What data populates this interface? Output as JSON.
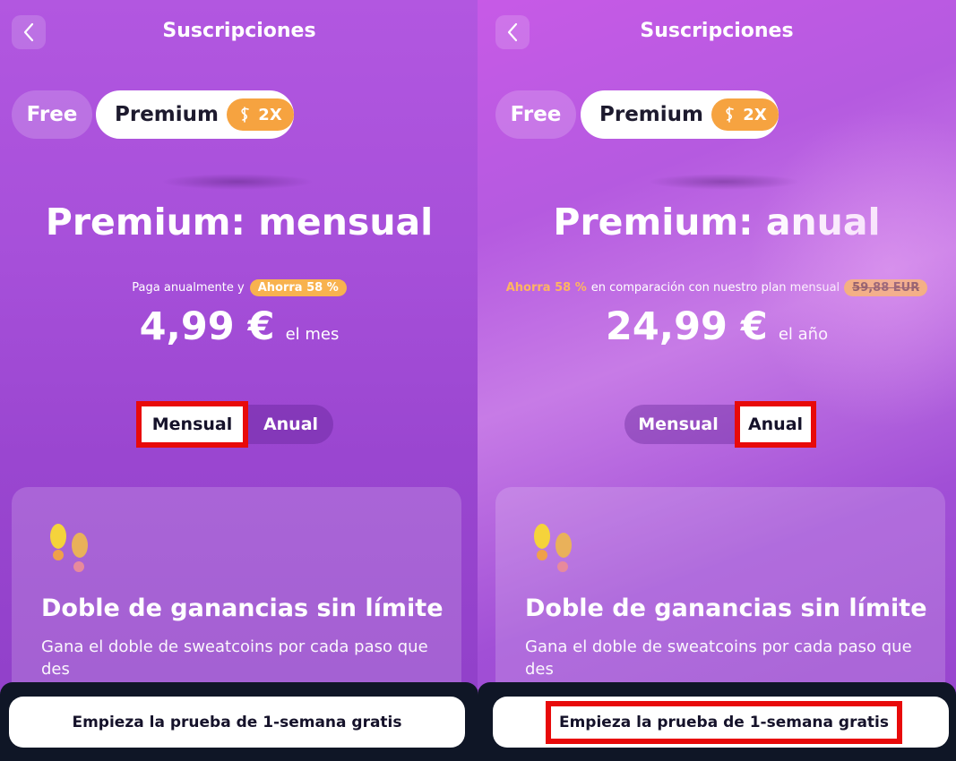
{
  "colors": {
    "accent_orange": "#f6a340",
    "highlight_red": "#e80a0a",
    "purple_bg": "#a64fd9",
    "dark_bar": "#0f1626"
  },
  "left": {
    "header": {
      "back_icon": "chevron-left-icon",
      "title": "Suscripciones"
    },
    "tiers": {
      "free": "Free",
      "premium": "Premium",
      "badge": "2X",
      "badge_icon": "sweatcoin-icon"
    },
    "plan_title": "Premium: mensual",
    "promo": {
      "text": "Paga anualmente y",
      "badge": "Ahorra 58 %"
    },
    "price": {
      "amount": "4,99 €",
      "period": "el mes"
    },
    "toggle": {
      "monthly": "Mensual",
      "annual": "Anual",
      "selected": "Mensual"
    },
    "feature": {
      "icon": "footprints-icon",
      "title": "Doble de ganancias sin límite",
      "description": "Gana el doble de sweatcoins por cada paso que des"
    },
    "cta": "Empieza la prueba de 1-semana gratis"
  },
  "right": {
    "header": {
      "back_icon": "chevron-left-icon",
      "title": "Suscripciones"
    },
    "tiers": {
      "free": "Free",
      "premium": "Premium",
      "badge": "2X",
      "badge_icon": "sweatcoin-icon"
    },
    "plan_title": "Premium: anual",
    "promo": {
      "highlight": "Ahorra 58 %",
      "text": "en comparación con nuestro plan mensual",
      "old_price": "59,88 EUR"
    },
    "price": {
      "amount": "24,99 €",
      "period": "el año"
    },
    "toggle": {
      "monthly": "Mensual",
      "annual": "Anual",
      "selected": "Anual"
    },
    "feature": {
      "icon": "footprints-icon",
      "title": "Doble de ganancias sin límite",
      "description": "Gana el doble de sweatcoins por cada paso que des"
    },
    "cta": "Empieza la prueba de 1-semana gratis"
  }
}
